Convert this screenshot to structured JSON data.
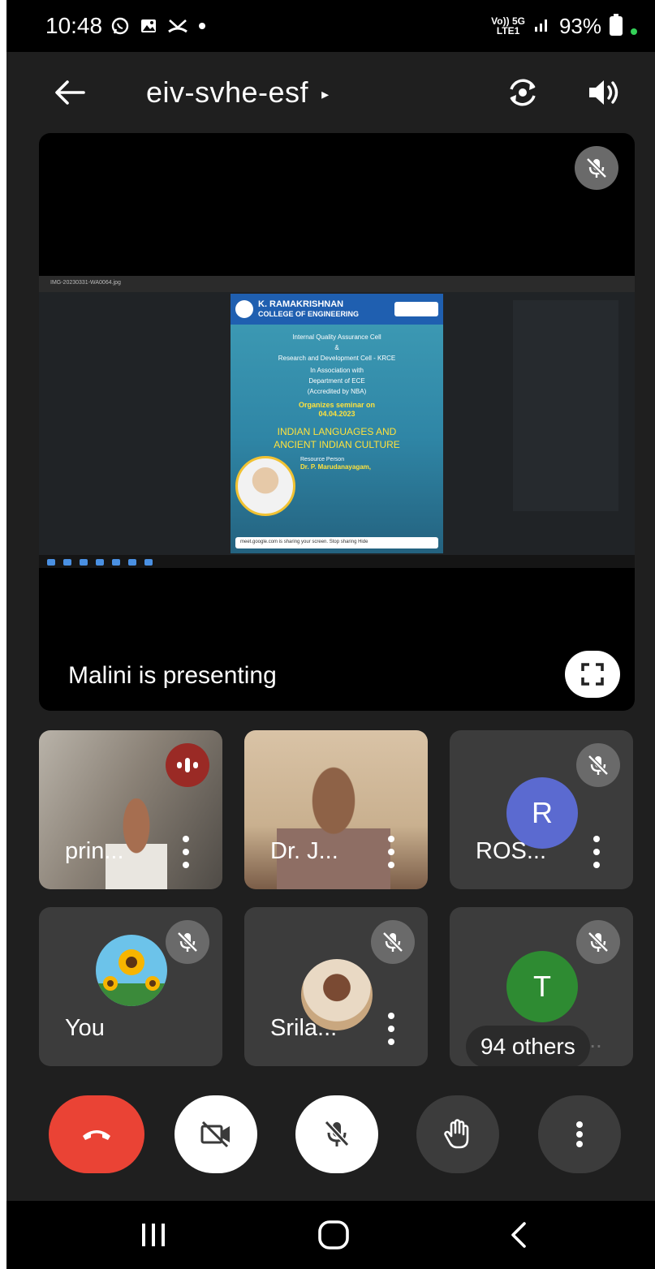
{
  "status_bar": {
    "time": "10:48",
    "network_top": "Vo)) 5G",
    "network_bottom": "LTE1",
    "battery": "93%"
  },
  "app_bar": {
    "meeting_code": "eiv-svhe-esf",
    "caret": "▸"
  },
  "stage": {
    "presenter_text": "Malini is presenting",
    "screen_share": {
      "file_label": "IMG-20230331-WA0064.jpg",
      "poster": {
        "institution": "K. RAMAKRISHNAN",
        "institution_sub": "COLLEGE OF ENGINEERING",
        "line1": "Internal Quality Assurance Cell",
        "line2": "&",
        "line3": "Research and Development Cell - KRCE",
        "line4": "In Association with",
        "line5": "Department of ECE",
        "line6": "(Accredited by NBA)",
        "organizes": "Organizes seminar on",
        "date": "04.04.2023",
        "title_line1": "INDIAN LANGUAGES AND",
        "title_line2": "ANCIENT INDIAN CULTURE",
        "resource_label": "Resource Person",
        "resource_name": "Dr. P. Marudanayagam,",
        "share_notice": "meet.google.com is sharing your screen.   Stop sharing   Hide"
      }
    }
  },
  "participants": [
    {
      "name": "prin...",
      "kind": "video"
    },
    {
      "name": "Dr. J...",
      "kind": "video"
    },
    {
      "name": "ROS...",
      "kind": "avatar",
      "initial": "R",
      "color": "#5b6ad0"
    },
    {
      "name": "You",
      "kind": "avatar-image"
    },
    {
      "name": "Srila...",
      "kind": "avatar-image"
    },
    {
      "name": "94 others",
      "kind": "avatar",
      "initial": "T",
      "color": "#2e8b32",
      "ghost_name": "T. Muruga..."
    }
  ],
  "colors": {
    "background": "#1f1f1f",
    "tile": "#3c3c3c",
    "hangup": "#ea4335",
    "speaking": "#9a2a25",
    "mute_badge": "#6a6a6a"
  },
  "icons": {
    "back": "arrow-left-icon",
    "switch_camera": "camera-switch-icon",
    "speaker": "speaker-icon",
    "fullscreen": "fullscreen-icon",
    "hangup": "phone-hangup-icon",
    "camera": "camera-off-icon",
    "mic": "mic-off-icon",
    "hand": "raise-hand-icon",
    "more": "more-vertical-icon"
  }
}
